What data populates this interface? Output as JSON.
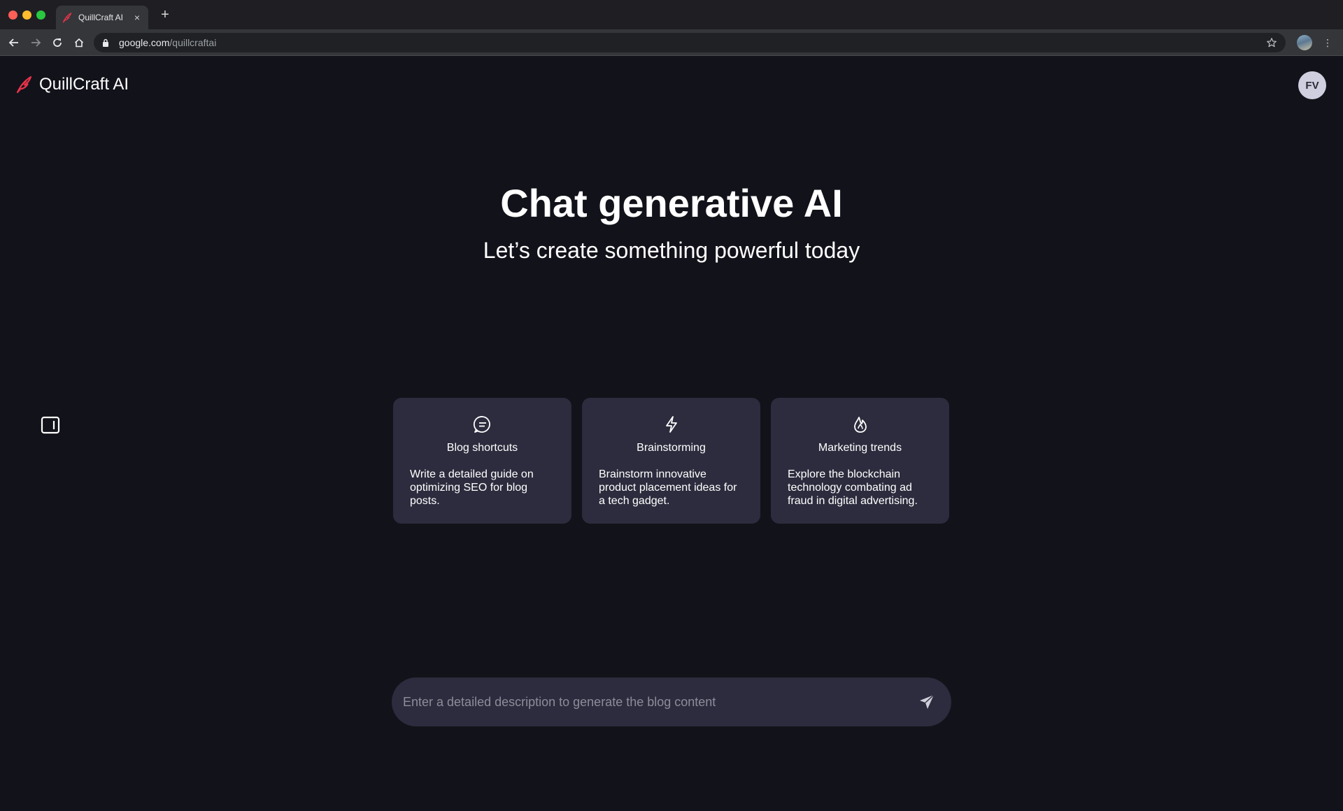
{
  "browser": {
    "tab_title": "QuillCraft AI",
    "tab_close": "×",
    "new_tab": "+",
    "url_host": "google.com",
    "url_path": "/quillcraftai",
    "menu": "⋮"
  },
  "app": {
    "brand_name": "QuillCraft AI",
    "avatar_initials": "FV",
    "accent_color": "#e8334a"
  },
  "hero": {
    "title": "Chat generative AI",
    "subtitle": "Let’s create something powerful today"
  },
  "cards": [
    {
      "icon": "chat-bubble-icon",
      "title": "Blog shortcuts",
      "description": "Write a detailed guide on optimizing SEO for blog posts."
    },
    {
      "icon": "lightning-icon",
      "title": "Brainstorming",
      "description": "Brainstorm innovative product placement ideas for a tech gadget."
    },
    {
      "icon": "flame-icon",
      "title": "Marketing trends",
      "description": "Explore the blockchain technology combating ad fraud in digital advertising."
    }
  ],
  "chat": {
    "placeholder": "Enter a detailed description to generate the blog content",
    "value": ""
  }
}
